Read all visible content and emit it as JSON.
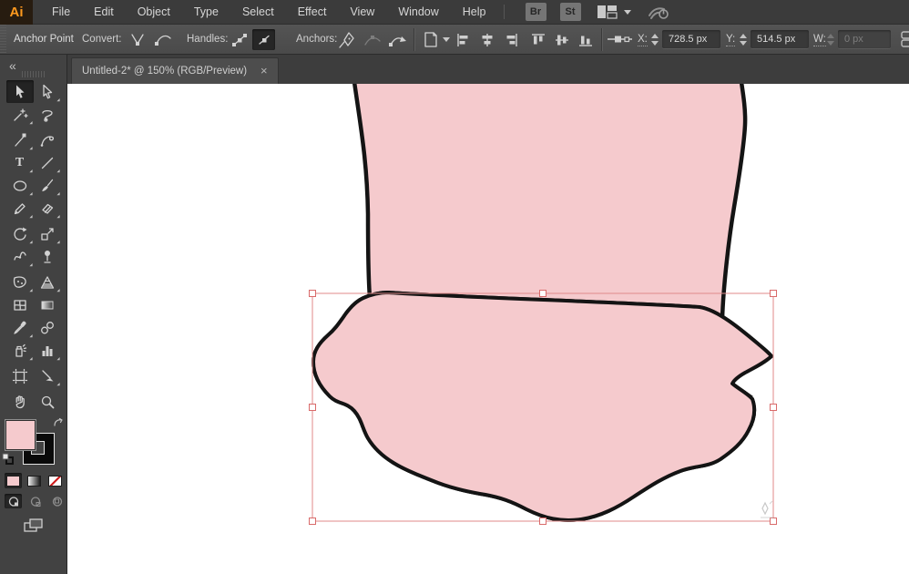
{
  "menu": {
    "logo": "Ai",
    "items": [
      "File",
      "Edit",
      "Object",
      "Type",
      "Select",
      "Effect",
      "View",
      "Window",
      "Help"
    ],
    "bridge_button": "Br",
    "stock_button": "St"
  },
  "control_bar": {
    "context_label": "Anchor Point",
    "convert_label": "Convert:",
    "handles_label": "Handles:",
    "anchors_label": "Anchors:",
    "x_label": "X:",
    "x_value": "728.5 px",
    "y_label": "Y:",
    "y_value": "514.5 px",
    "w_label": "W:",
    "w_value": "0 px"
  },
  "tab": {
    "title": "Untitled-2* @ 150% (RGB/Preview)",
    "close_glyph": "×"
  },
  "toolbar": {
    "collapse_glyph": "«",
    "type_tool_glyph": "T",
    "active_tool": "selection",
    "tools": [
      "selection",
      "direct-selection",
      "magic-wand",
      "lasso",
      "pen",
      "curvature",
      "type",
      "line-segment",
      "ellipse",
      "paintbrush",
      "pencil",
      "eraser",
      "rotate",
      "scale",
      "width",
      "puppet-warp",
      "shape-builder",
      "perspective-grid",
      "mesh",
      "gradient",
      "eyedropper",
      "blend",
      "symbol-sprayer",
      "column-graph",
      "artboard",
      "slice",
      "hand",
      "zoom"
    ],
    "fill_color": "#F5CACD",
    "stroke_color": "#0A0A0A"
  },
  "canvas": {
    "artboard_color": "#FFFFFF",
    "shape_fill": "#F5CACD",
    "shape_stroke": "#141414",
    "selection_accent": "#E05C5C",
    "bbox_color": "#E08A8A"
  },
  "colors": {
    "menu_bar": "#3B3B3B",
    "control_bar": "#4F4F4F",
    "panel": "#424242",
    "tab_strip": "#3D3D3D",
    "active_tab": "#4D4D4D",
    "logo_orange": "#FF9A1E"
  }
}
